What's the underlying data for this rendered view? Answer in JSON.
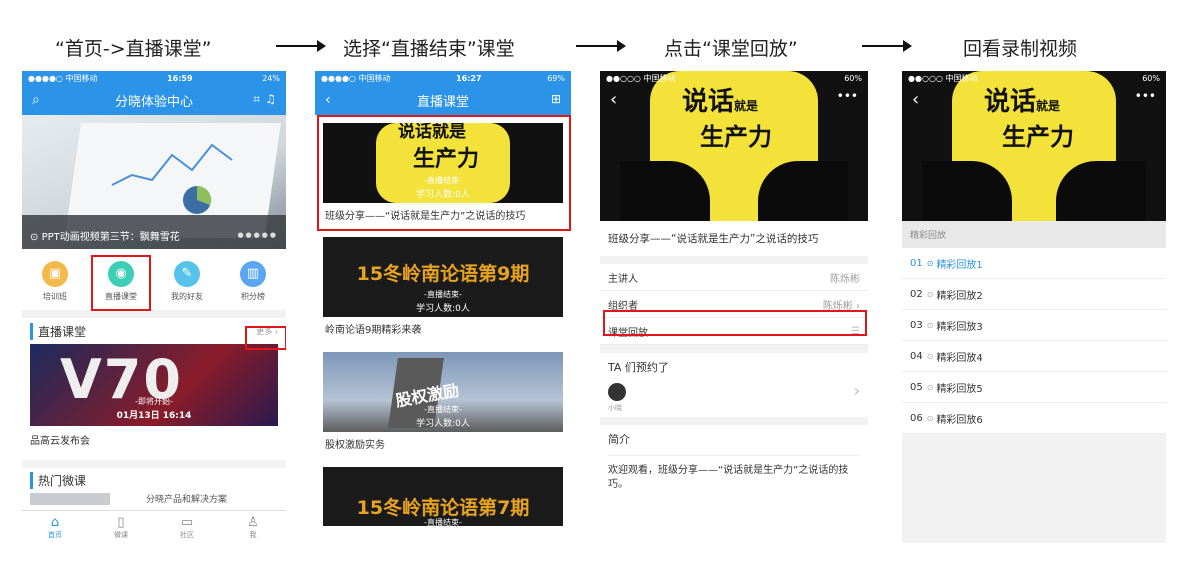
{
  "steps": [
    "“首页->直播课堂”",
    "选择“直播结束”课堂",
    "点击“课堂回放”",
    "回看录制视频"
  ],
  "phone1": {
    "carrier": "●●●●○ 中国移动",
    "time": "16:59",
    "battery": "24%",
    "title": "分晓体验中心",
    "banner_caption": "PPT动画视频第三节：飘舞雪花",
    "icons": [
      {
        "label": "培训班",
        "icon": "board-icon",
        "color": "#f3b94a"
      },
      {
        "label": "直播课堂",
        "icon": "camera-icon",
        "color": "#3dcfb5"
      },
      {
        "label": "我的好友",
        "icon": "pencil-icon",
        "color": "#56c3ea"
      },
      {
        "label": "积分榜",
        "icon": "chart-icon",
        "color": "#5aa6f0"
      }
    ],
    "section_live": "直播课堂",
    "more": "更多",
    "live_poster_big": "V70",
    "live_poster_status": "-即将开始-",
    "live_poster_date": "01月13日 16:14",
    "live_caption": "品高云发布会",
    "section_hot": "热门微课",
    "hot_item": "分晓产品和解决方案",
    "tabs": [
      "首页",
      "微课",
      "社区",
      "我"
    ]
  },
  "phone2": {
    "carrier": "●●●●○ 中国移动",
    "time": "16:27",
    "battery": "69%",
    "title": "直播课堂",
    "cards": [
      {
        "big": "生产力",
        "top": "说话就是",
        "status": "-直播结束-",
        "count": "学习人数:0人",
        "caption": "班级分享——“说话就是生产力”之说话的技巧"
      },
      {
        "big": "15冬岭南论语第9期",
        "status": "-直播结束-",
        "count": "学习人数:0人",
        "caption": "岭南论语9期精彩来袭"
      },
      {
        "big": "股权激励",
        "status": "-直播结束-",
        "count": "学习人数:0人",
        "caption": "股权激励实务"
      },
      {
        "big": "15冬岭南论语第7期",
        "status": "-直播结束-",
        "count": "",
        "caption": ""
      }
    ]
  },
  "phone3": {
    "carrier": "●●○○○ 中国移动",
    "battery": "60%",
    "poster_top": "说话",
    "poster_small": "就是",
    "poster_bottom": "生产力",
    "title": "班级分享——“说话就是生产力”之说话的技巧",
    "rows": [
      {
        "label": "主讲人",
        "value": "陈烁彬"
      },
      {
        "label": "组织者",
        "value": "陈烁彬"
      },
      {
        "label": "课堂回放",
        "value": ""
      }
    ],
    "reserved": "TA 们预约了",
    "reserved_user": "小晓",
    "intro_title": "简介",
    "intro_text": "欢迎观看，班级分享——“说话就是生产力”之说话的技巧。"
  },
  "phone4": {
    "carrier": "●●○○○ 中国移动",
    "battery": "60%",
    "poster_top": "说话",
    "poster_small": "就是",
    "poster_bottom": "生产力",
    "section": "精彩回放",
    "items": [
      {
        "num": "01",
        "label": "精彩回放1",
        "active": true
      },
      {
        "num": "02",
        "label": "精彩回放2",
        "active": false
      },
      {
        "num": "03",
        "label": "精彩回放3",
        "active": false
      },
      {
        "num": "04",
        "label": "精彩回放4",
        "active": false
      },
      {
        "num": "05",
        "label": "精彩回放5",
        "active": false
      },
      {
        "num": "06",
        "label": "精彩回放6",
        "active": false
      }
    ]
  }
}
